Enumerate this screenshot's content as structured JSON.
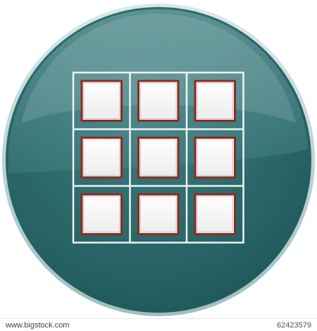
{
  "image": {
    "subject": "grid-icon-button",
    "colors": {
      "button_base": "#2a6668",
      "button_dark": "#1d5456",
      "button_highlight": "#6fa5a8",
      "grid_outline": "#f2f2f2",
      "tile_fill": "#ffffff",
      "tile_border": "#8e2b22"
    },
    "grid": {
      "rows": 3,
      "cols": 3
    }
  },
  "watermark": {
    "site": "www.bigstock.com",
    "id": "62423579"
  }
}
